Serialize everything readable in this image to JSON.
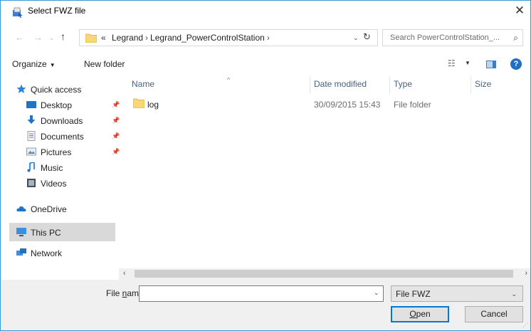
{
  "window": {
    "title": "Select FWZ file",
    "close_glyph": "✕"
  },
  "navigation": {
    "back_glyph": "←",
    "forward_glyph": "→",
    "recent_glyph": "⌄",
    "up_glyph": "↑",
    "breadcrumb_lead": "«",
    "breadcrumbs": [
      "Legrand",
      "Legrand_PowerControlStation"
    ],
    "crumb_separator": "›",
    "address_dropdown_glyph": "⌄",
    "refresh_glyph": "↻",
    "search_placeholder": "Search PowerControlStation_...",
    "search_glyph": "⌕"
  },
  "toolbar": {
    "organize_label": "Organize",
    "organize_caret": "▼",
    "new_folder_label": "New folder",
    "views_glyph": "☷",
    "views_caret": "▼",
    "help_glyph": "?"
  },
  "sidebar": {
    "items": [
      {
        "label": "Quick access",
        "icon": "star-icon"
      },
      {
        "label": "Desktop",
        "icon": "desktop-icon",
        "pinned": true
      },
      {
        "label": "Downloads",
        "icon": "download-icon",
        "pinned": true
      },
      {
        "label": "Documents",
        "icon": "documents-icon",
        "pinned": true
      },
      {
        "label": "Pictures",
        "icon": "pictures-icon",
        "pinned": true
      },
      {
        "label": "Music",
        "icon": "music-icon"
      },
      {
        "label": "Videos",
        "icon": "videos-icon"
      },
      {
        "label": "OneDrive",
        "icon": "cloud-icon"
      },
      {
        "label": "This PC",
        "icon": "computer-icon",
        "selected": true
      },
      {
        "label": "Network",
        "icon": "network-icon"
      }
    ],
    "pin_glyph": "📌"
  },
  "filelist": {
    "columns": [
      "Name",
      "Date modified",
      "Type",
      "Size"
    ],
    "sort_glyph": "^",
    "rows": [
      {
        "name": "log",
        "date_modified": "30/09/2015 15:43",
        "type": "File folder",
        "size": ""
      }
    ]
  },
  "scrollbar": {
    "left_glyph": "‹",
    "right_glyph": "›"
  },
  "footer": {
    "file_name_label_pre": "File ",
    "file_name_label_accel": "n",
    "file_name_label_post": "ame:",
    "file_name_value": "",
    "file_name_dropdown_glyph": "⌄",
    "file_type_value": "File FWZ",
    "file_type_dropdown_glyph": "⌄",
    "open_label_accel": "O",
    "open_label_rest": "pen",
    "cancel_label": "Cancel",
    "grip_glyph": "⋰"
  },
  "colors": {
    "accent": "#0078d7",
    "folder": "#f8d775",
    "selection": "#d9d9d9"
  }
}
